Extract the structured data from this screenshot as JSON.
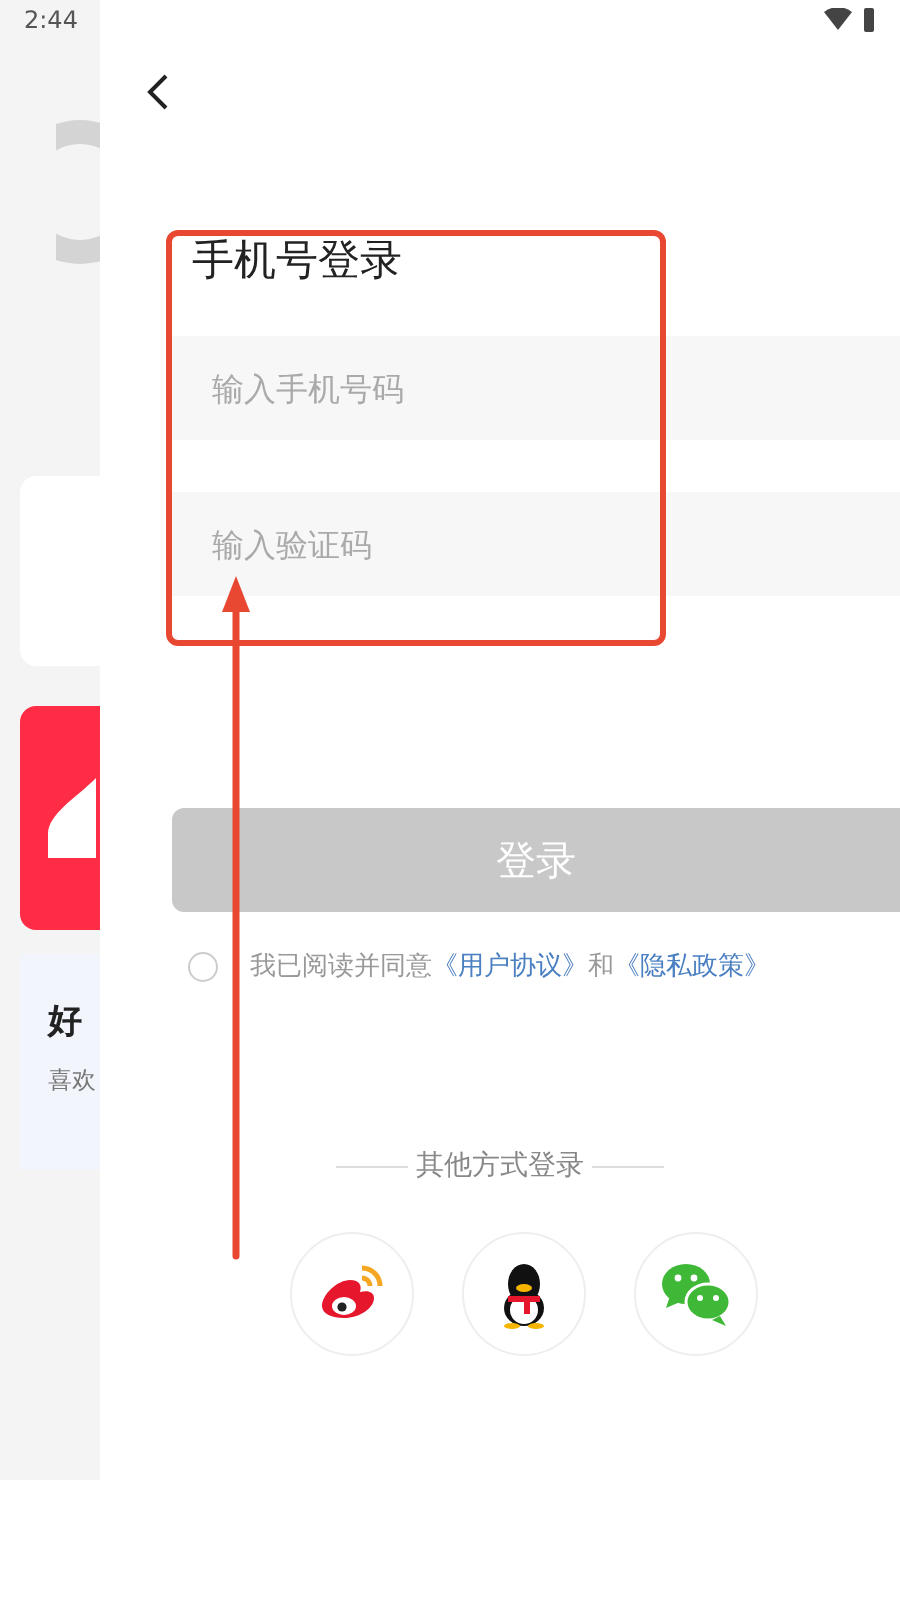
{
  "status_bar": {
    "time": "2:44"
  },
  "background_app": {
    "card_title": "好",
    "card_subtitle": "喜欢"
  },
  "login": {
    "title": "手机号登录",
    "phone_field": {
      "placeholder": "输入手机号码"
    },
    "code_field": {
      "placeholder": "输入验证码"
    },
    "login_button": {
      "label": "登录",
      "disabled": true
    },
    "agreement": {
      "checked": false,
      "parts": [
        {
          "text": "我已阅读并同意",
          "kind": "plain"
        },
        {
          "text": "《用户协议》",
          "kind": "link"
        },
        {
          "text": "和",
          "kind": "plain"
        },
        {
          "text": "《隐私政策》",
          "kind": "link"
        }
      ]
    },
    "other_methods": {
      "label": "其他方式登录",
      "providers": [
        {
          "kind": "weibo"
        },
        {
          "kind": "qq"
        },
        {
          "kind": "wechat"
        }
      ]
    }
  }
}
